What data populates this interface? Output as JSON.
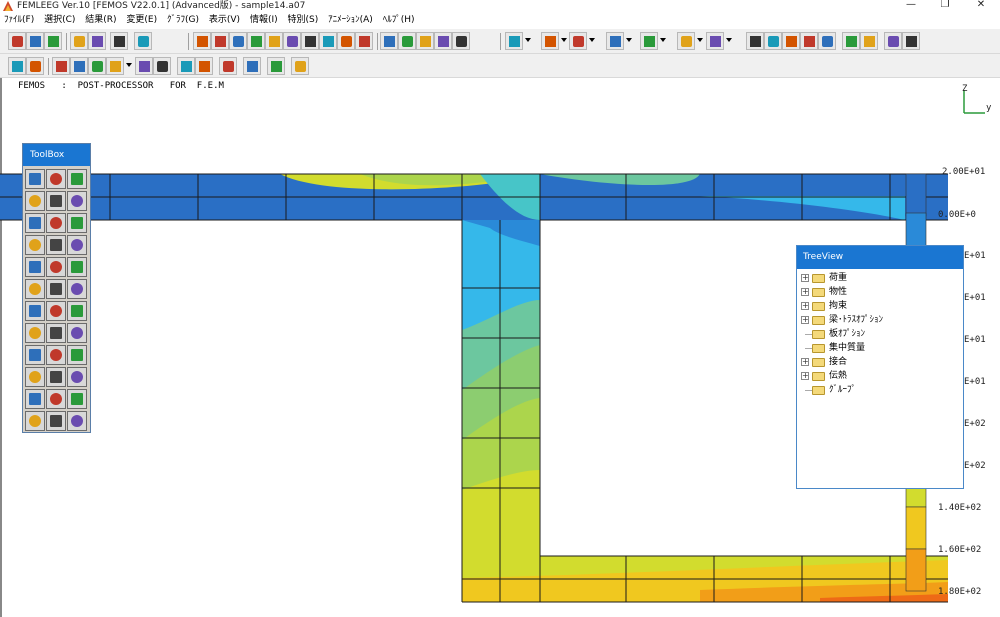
{
  "window": {
    "title": "FEMLEEG Ver.10 [FEMOS V22.0.1] (Advanced版) - sample14.a07",
    "minimize_glyph": "—",
    "restore_glyph": "❐",
    "close_glyph": "✕"
  },
  "menu": {
    "items": [
      "ﾌｧｲﾙ(F)",
      "選択(C)",
      "結果(R)",
      "変更(E)",
      "ｸﾞﾗﾌ(G)",
      "表示(V)",
      "情報(I)",
      "特別(S)",
      "ｱﾆﾒｰｼｮﾝ(A)",
      "ﾍﾙﾌﾟ(H)"
    ]
  },
  "canvas": {
    "header": "FEMOS   :  POST-PROCESSOR   FOR  F.E.M",
    "axis_z": "Z",
    "axis_y": "y"
  },
  "legend": {
    "labels": [
      "0.00E+0",
      "1.40E+02",
      "1.60E+02",
      "1.80E+02"
    ],
    "top_partial": "2.00E+01",
    "partial_labels": [
      "E+01",
      "E+01",
      "E+01",
      "E+01",
      "E+02",
      "E+02"
    ],
    "colors": [
      "#2f5fb0",
      "#2a6fc5",
      "#2a8ad8",
      "#35b8ea",
      "#47c5c8",
      "#6cc79f",
      "#8ccd70",
      "#acd54c",
      "#d2dc2e",
      "#f0c81f",
      "#f29e18",
      "#ee6a16",
      "#e52a1c"
    ]
  },
  "toolbox": {
    "title": "ToolBox"
  },
  "treeview": {
    "title": "TreeView",
    "items": [
      {
        "label": "荷重",
        "expandable": true
      },
      {
        "label": "物性",
        "expandable": true
      },
      {
        "label": "拘束",
        "expandable": true
      },
      {
        "label": "梁･ﾄﾗｽｵﾌﾟｼｮﾝ",
        "expandable": true
      },
      {
        "label": "板ｵﾌﾟｼｮﾝ",
        "expandable": false
      },
      {
        "label": "集中質量",
        "expandable": false
      },
      {
        "label": "接合",
        "expandable": true
      },
      {
        "label": "伝熱",
        "expandable": true
      },
      {
        "label": "ｸﾞﾙｰﾌﾟ",
        "expandable": false
      }
    ]
  },
  "colors": {
    "title_accent": "#1a76d2",
    "toolbar_bg": "#f0f0f0",
    "grid_line": "#1a1a1a"
  }
}
